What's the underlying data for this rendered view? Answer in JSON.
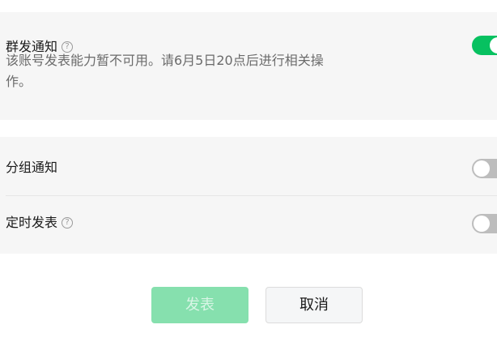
{
  "settings": {
    "group_notice": {
      "label": "群发通知",
      "description": "该账号发表能力暂不可用。请6月5日20点后进行相关操作。",
      "enabled": true
    },
    "group_by_tag": {
      "label": "分组通知",
      "enabled": false
    },
    "scheduled": {
      "label": "定时发表",
      "enabled": false
    }
  },
  "help_glyph": "?",
  "icons": {
    "help": "help-circle-icon"
  },
  "actions": {
    "publish_label": "发表",
    "cancel_label": "取消"
  },
  "colors": {
    "accent_on": "#07c160",
    "toggle_off": "#bdbdbd",
    "publish_disabled_bg": "#86e0ae"
  }
}
